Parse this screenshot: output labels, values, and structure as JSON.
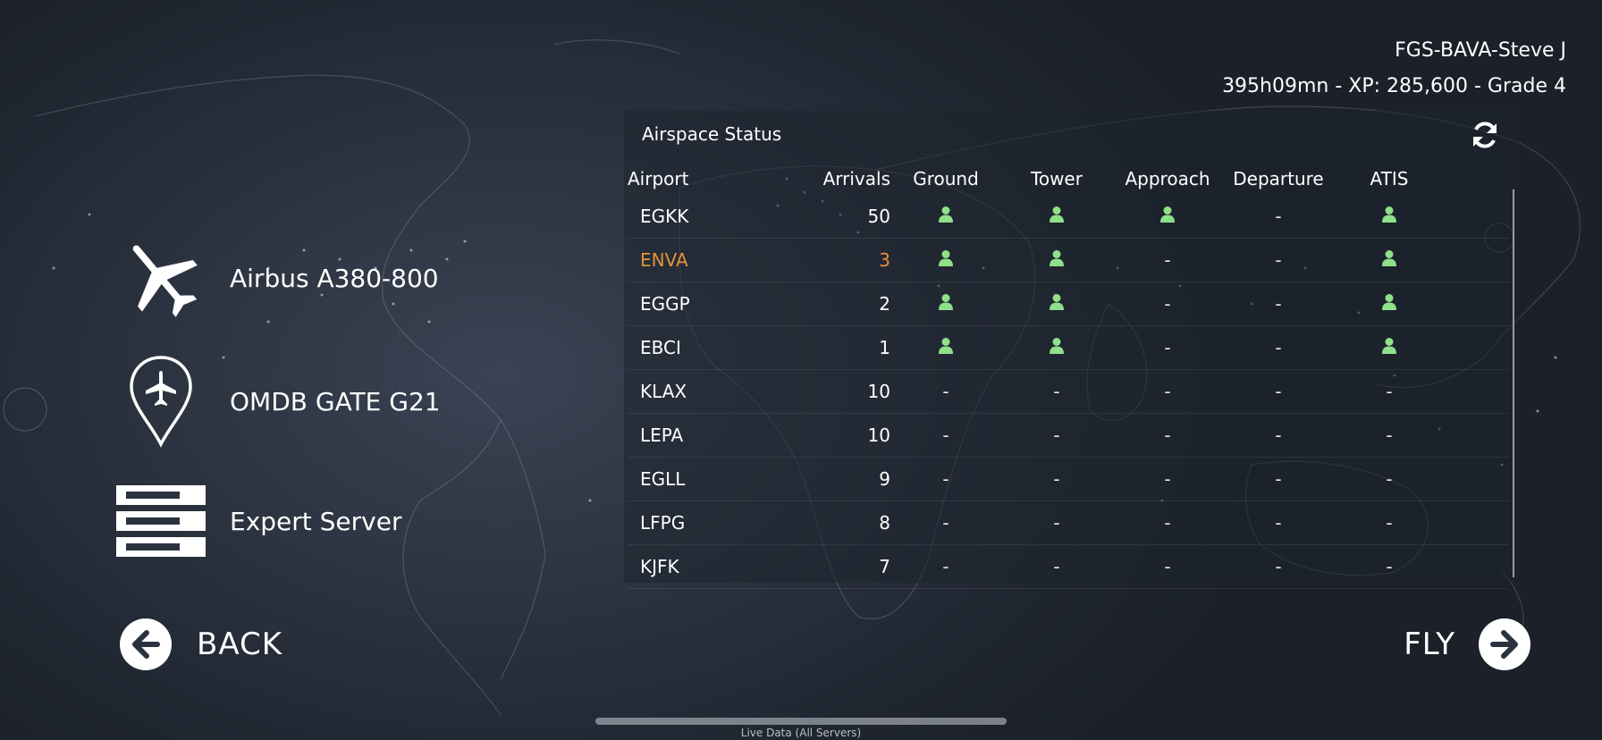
{
  "user": {
    "name": "FGS-BAVA-Steve J",
    "stats": "395h09mn - XP: 285,600 - Grade 4"
  },
  "menu": {
    "aircraft": {
      "label": "Airbus A380-800",
      "icon": "airplane-icon"
    },
    "location": {
      "label": "OMDB GATE G21",
      "icon": "map-pin-airplane-icon"
    },
    "server": {
      "label": "Expert Server",
      "icon": "server-stack-icon"
    }
  },
  "nav": {
    "back_label": "BACK",
    "fly_label": "FLY"
  },
  "panel": {
    "title": "Airspace Status",
    "columns": [
      "Airport",
      "Arrivals",
      "Ground",
      "Tower",
      "Approach",
      "Departure",
      "ATIS"
    ],
    "rows": [
      {
        "airport": "EGKK",
        "arrivals": "50",
        "ground": true,
        "tower": true,
        "approach": true,
        "departure": false,
        "atis": true,
        "highlight": false
      },
      {
        "airport": "ENVA",
        "arrivals": "3",
        "ground": true,
        "tower": true,
        "approach": false,
        "departure": false,
        "atis": true,
        "highlight": true
      },
      {
        "airport": "EGGP",
        "arrivals": "2",
        "ground": true,
        "tower": true,
        "approach": false,
        "departure": false,
        "atis": true,
        "highlight": false
      },
      {
        "airport": "EBCI",
        "arrivals": "1",
        "ground": true,
        "tower": true,
        "approach": false,
        "departure": false,
        "atis": true,
        "highlight": false
      },
      {
        "airport": "KLAX",
        "arrivals": "10",
        "ground": false,
        "tower": false,
        "approach": false,
        "departure": false,
        "atis": false,
        "highlight": false
      },
      {
        "airport": "LEPA",
        "arrivals": "10",
        "ground": false,
        "tower": false,
        "approach": false,
        "departure": false,
        "atis": false,
        "highlight": false
      },
      {
        "airport": "EGLL",
        "arrivals": "9",
        "ground": false,
        "tower": false,
        "approach": false,
        "departure": false,
        "atis": false,
        "highlight": false
      },
      {
        "airport": "LFPG",
        "arrivals": "8",
        "ground": false,
        "tower": false,
        "approach": false,
        "departure": false,
        "atis": false,
        "highlight": false
      },
      {
        "airport": "KJFK",
        "arrivals": "7",
        "ground": false,
        "tower": false,
        "approach": false,
        "departure": false,
        "atis": false,
        "highlight": false
      }
    ],
    "empty_marker": "-"
  },
  "footer": {
    "label": "Live Data (All Servers)"
  },
  "colors": {
    "controller_green": "#8fe08a",
    "highlight_orange": "#e69138"
  }
}
